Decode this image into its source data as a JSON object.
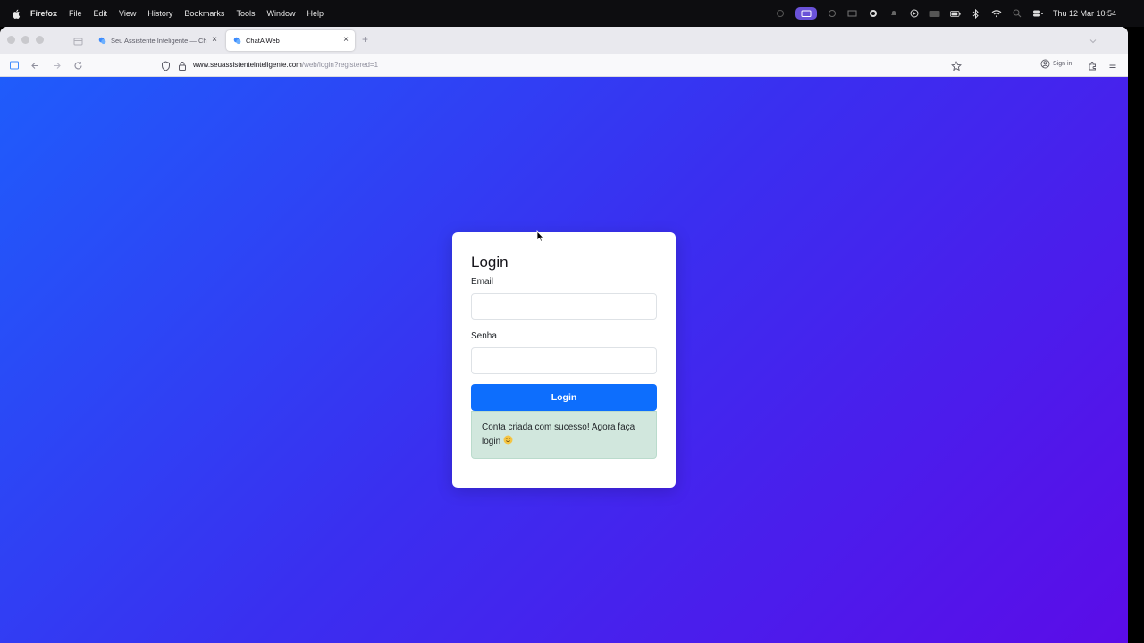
{
  "menubar": {
    "app_name": "Firefox",
    "menus": [
      "File",
      "Edit",
      "View",
      "History",
      "Bookmarks",
      "Tools",
      "Window",
      "Help"
    ],
    "clock": "Thu 12 Mar  10:54"
  },
  "browser": {
    "tabs": [
      {
        "title": "Seu Assistente Inteligente — Ch",
        "active": false
      },
      {
        "title": "ChatAiWeb",
        "active": true
      }
    ],
    "url_host": "www.seuassistenteinteligente.com",
    "url_path": "/web/login?registered=1",
    "sign_in_label": "Sign in"
  },
  "login": {
    "title": "Login",
    "email_label": "Email",
    "email_value": "",
    "password_label": "Senha",
    "password_value": "",
    "submit_label": "Login",
    "success_message": "Conta criada com sucesso! Agora faça login",
    "success_emoji": "smiling-face-icon"
  },
  "colors": {
    "gradient_start": "#1f5cfb",
    "gradient_mid": "#3a2ff0",
    "gradient_end": "#5b0ce8",
    "primary_button": "#0d6efd",
    "success_bg": "#d1e7dd"
  }
}
